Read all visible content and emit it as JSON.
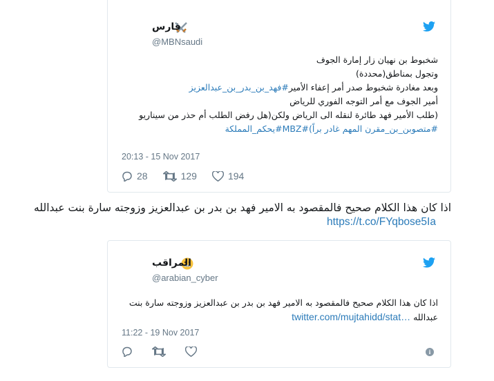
{
  "tweet1": {
    "name": "فارس",
    "handle": "@MBNsaudi",
    "lines": [
      {
        "text": "شخبوط بن نهيان زار إمارة الجوف",
        "link": false
      },
      {
        "text": "وتجول بمناطق(محددة)",
        "link": false
      },
      {
        "text": "وبعد مغادرة شخبوط صدر أمر إعفاء الأمير",
        "linktext": "#فهد_بن_بدر_بن_عبدالعزيز",
        "link": "mixed"
      },
      {
        "text": "أمير الجوف مع أمر التوجه الفوري للرياض",
        "link": false
      },
      {
        "text": "(طلب الأمير فهد طائرة لنقله الى الرياض ولكن(هل رفض الطلب أم حذر من سيناريو",
        "link": false
      },
      {
        "text": "#متصوبن_بن_مقرن المهم غادر براً)",
        "linktext": "#MBZ",
        "tail": "#يحكم_المملكة",
        "link": "mixed2"
      }
    ],
    "timestamp": "20:13 - 15 Nov 2017",
    "replies": "28",
    "retweets": "129",
    "likes": "194"
  },
  "middle": {
    "text": "اذا كان هذا الكلام صحيح فالمقصود به الامير فهد بن بدر بن عبدالعزيز وزوجته سارة بنت عبدالله",
    "link": "https://t.co/FYqbose5Ia"
  },
  "tweet2": {
    "name": "المراقب",
    "handle": "@arabian_cyber",
    "line1": "اذا كان هذا الكلام صحيح فالمقصود به الامير فهد بن بدر بن عبدالعزيز وزوجته سارة بنت",
    "line2": "عبدالله",
    "link": "twitter.com/mujtahidd/stat…",
    "timestamp": "11:22 - 19 Nov 2017"
  },
  "colors": {
    "twitter_blue": "#1da1f2",
    "link": "#2b7bb9",
    "muted": "#657786"
  },
  "icons": [
    "twitter-bird-icon",
    "crossed-swords-icon",
    "reply-icon",
    "retweet-icon",
    "heart-icon",
    "info-icon",
    "zipper-mouth-emoji-icon"
  ]
}
